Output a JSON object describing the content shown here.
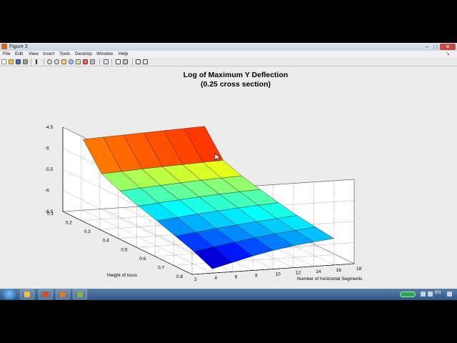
{
  "window": {
    "title": "Figure 3"
  },
  "menu": {
    "items": [
      "File",
      "Edit",
      "View",
      "Insert",
      "Tools",
      "Desktop",
      "Window",
      "Help"
    ]
  },
  "plot": {
    "title": "Log of Maximum Y Deflection",
    "subtitle": "(0.25 cross section)"
  },
  "chart_data": {
    "type": "surface",
    "title": "Log of Maximum Y Deflection",
    "subtitle": "(0.25 cross section)",
    "xlabel": "Number of horizontal Segments",
    "ylabel": "Height of truss",
    "zlabel": "",
    "x": [
      4,
      6,
      8,
      10,
      12,
      14,
      16
    ],
    "y": [
      0.1,
      0.2,
      0.3,
      0.4,
      0.5,
      0.6,
      0.7,
      0.8
    ],
    "z": [
      [
        -4.82,
        -4.8,
        -4.78,
        -4.76,
        -4.74,
        -4.72,
        -4.7
      ],
      [
        -5.42,
        -5.4,
        -5.37,
        -5.35,
        -5.33,
        -5.31,
        -5.29
      ],
      [
        -5.62,
        -5.58,
        -5.55,
        -5.52,
        -5.49,
        -5.47,
        -5.45
      ],
      [
        -5.76,
        -5.72,
        -5.68,
        -5.64,
        -5.61,
        -5.58,
        -5.56
      ],
      [
        -5.9,
        -5.85,
        -5.8,
        -5.76,
        -5.72,
        -5.69,
        -5.66
      ],
      [
        -6.05,
        -5.99,
        -5.93,
        -5.88,
        -5.83,
        -5.79,
        -5.75
      ],
      [
        -6.2,
        -6.12,
        -6.04,
        -5.97,
        -5.91,
        -5.86,
        -5.81
      ],
      [
        -6.4,
        -6.28,
        -6.16,
        -6.06,
        -5.98,
        -5.92,
        -5.87
      ]
    ],
    "x_ticks": [
      2,
      4,
      6,
      8,
      10,
      12,
      14,
      16,
      18
    ],
    "y_ticks": [
      0.1,
      0.2,
      0.3,
      0.4,
      0.5,
      0.6,
      0.7,
      0.8
    ],
    "z_ticks": [
      -4.5,
      -5,
      -5.5,
      -6,
      -6.5
    ],
    "xlim": [
      2,
      18
    ],
    "ylim": [
      0.1,
      0.8
    ],
    "zlim": [
      -6.5,
      -4.5
    ],
    "grid": true,
    "colormap": "jet"
  },
  "taskbar": {
    "language": "EN"
  }
}
